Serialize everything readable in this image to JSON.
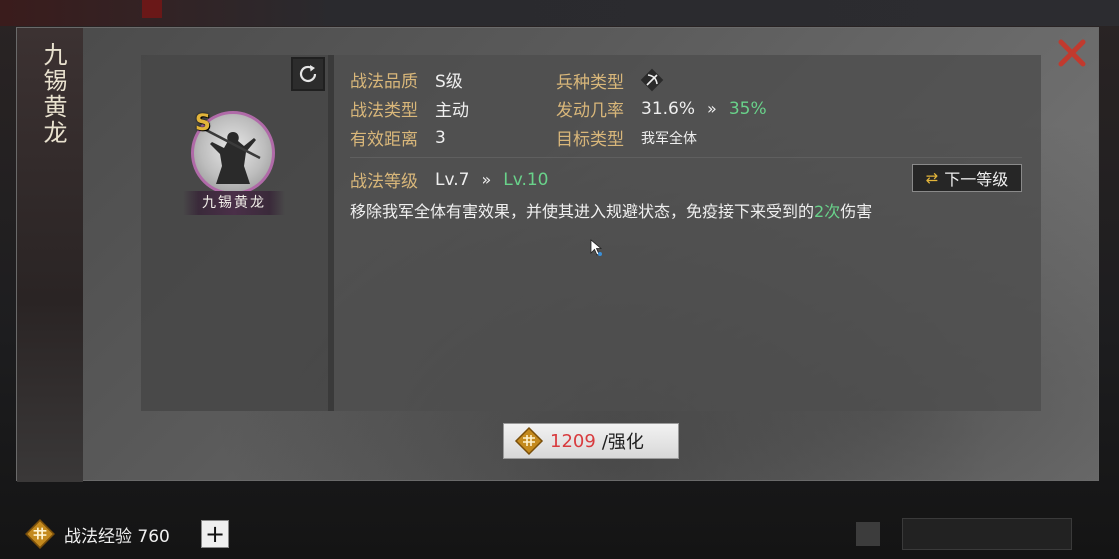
{
  "background": {
    "tabs": [
      "",
      "",
      ""
    ]
  },
  "dialog": {
    "vertical_title": "九锡黄龙",
    "close_symbol": "✕"
  },
  "portrait": {
    "grade": "S",
    "name": "九锡黄龙"
  },
  "info": {
    "quality_label": "战法品质",
    "quality_value": "S级",
    "unit_type_label": "兵种类型",
    "type_label": "战法类型",
    "type_value": "主动",
    "rate_label": "发动几率",
    "rate_current": "31.6%",
    "rate_next": "35%",
    "range_label": "有效距离",
    "range_value": "3",
    "target_label": "目标类型",
    "target_value": "我军全体",
    "level_label": "战法等级",
    "level_current": "Lv.7",
    "level_next": "Lv.10",
    "arrow": "»",
    "next_level_button": "下一等级",
    "description_prefix": "移除我军全体有害效果，并使其进入规避状态，免疫接下来受到的",
    "description_highlight": "2次",
    "description_suffix": "伤害"
  },
  "upgrade": {
    "cost": "1209",
    "label": "/强化"
  },
  "bottom": {
    "exp_label": "战法经验 760",
    "plus": "+"
  },
  "colors": {
    "accent_gold": "#d9b77a",
    "upgrade_green": "#69d28a",
    "cost_red": "#d83b3e",
    "close_red": "#c13a2e",
    "portrait_ring": "#b06aa8"
  }
}
